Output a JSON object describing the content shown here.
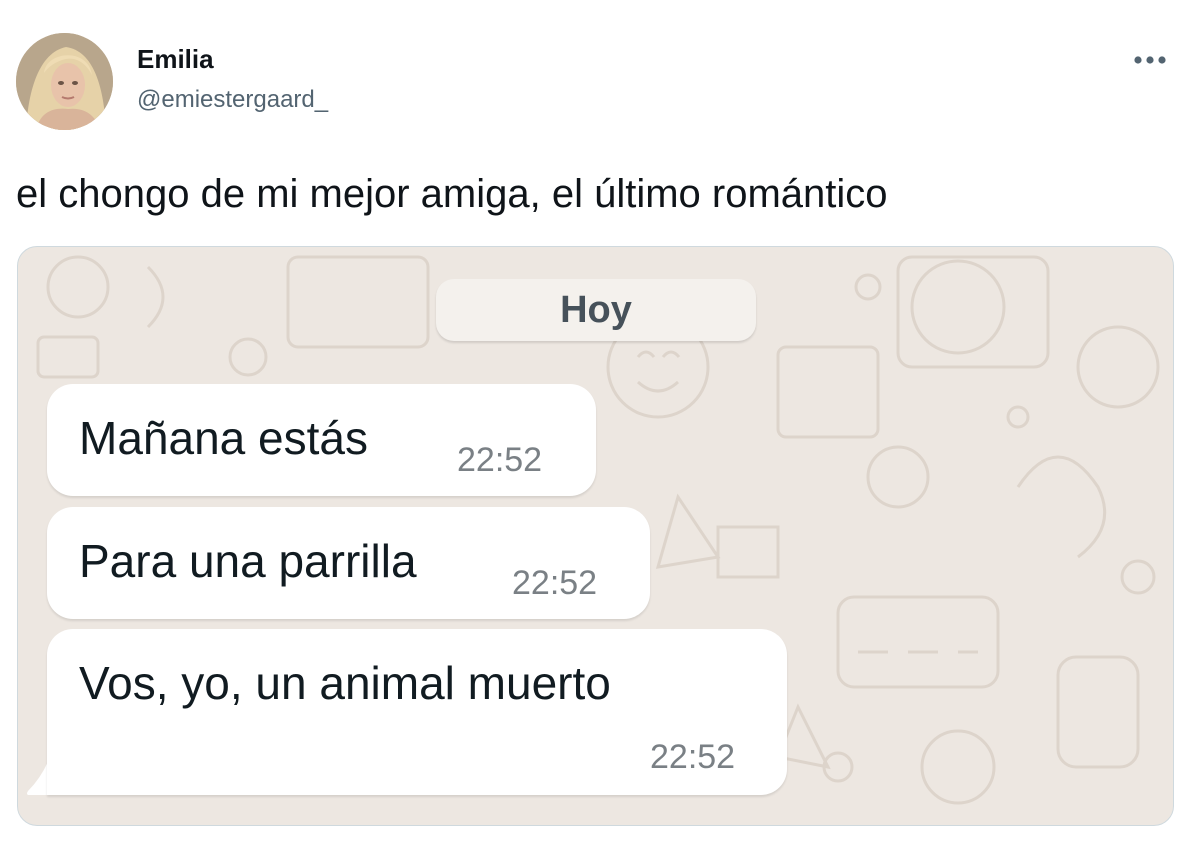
{
  "tweet": {
    "author_name": "Emilia",
    "author_handle": "@emiestergaard_",
    "text": "el chongo de mi mejor amiga, el último romántico",
    "more_icon": "more-horizontal-icon"
  },
  "chat": {
    "date_label": "Hoy",
    "messages": [
      {
        "text": "Mañana estás",
        "time": "22:52"
      },
      {
        "text": "Para una parrilla",
        "time": "22:52"
      },
      {
        "text": "Vos, yo, un animal muerto",
        "time": "22:52"
      }
    ]
  },
  "colors": {
    "chat_background": "#ede7e1",
    "bubble": "#ffffff",
    "handle": "#536471",
    "text": "#0f1419"
  }
}
